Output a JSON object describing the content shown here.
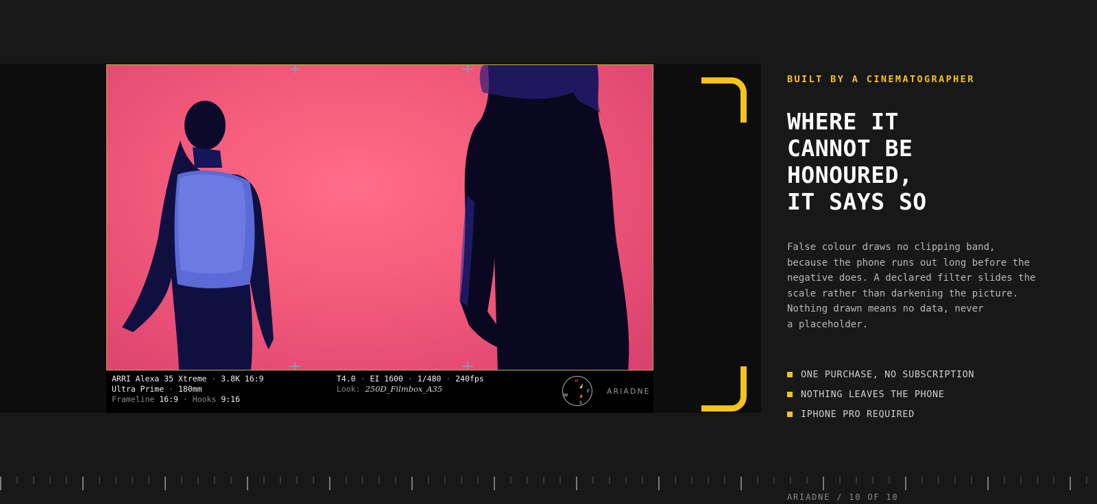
{
  "viewer": {
    "camera": "ARRI Alexa 35 Xtreme",
    "resolution": "3.8K 16:9",
    "lens": "Ultra Prime",
    "focal": "180mm",
    "frameline_label": "Frameline",
    "frameline_value": "16:9",
    "hooks_label": "Hooks",
    "hooks_value": "9:16",
    "stop": "T4.0",
    "ei": "EI 1600",
    "shutter": "1/480",
    "fps": "240fps",
    "look_label": "Look:",
    "look_value": "250D_Filmbox_A35",
    "separator": "·",
    "compass": {
      "n": "N",
      "e": "E",
      "s": "S",
      "w": "W"
    },
    "logo": "ARIADNE"
  },
  "panel": {
    "eyebrow": "BUILT BY A CINEMATOGRAPHER",
    "headline_lines": [
      "WHERE IT",
      "CANNOT BE",
      "HONOURED,",
      "IT SAYS SO"
    ],
    "body_lines": [
      "False colour draws no clipping band,",
      "because the phone runs out long before the",
      "negative does. A declared filter slides the",
      "scale rather than darkening the picture.",
      "Nothing drawn means no data, never",
      "a placeholder."
    ],
    "bullets": [
      "ONE PURCHASE, NO SUBSCRIPTION",
      "NOTHING LEAVES THE PHONE",
      "IPHONE PRO REQUIRED"
    ]
  },
  "footer": {
    "label": "ARIADNE / 10 OF 10"
  },
  "colors": {
    "accent": "#f7c21b",
    "frame_border": "#c9b43a",
    "background": "#181818"
  },
  "icons": [
    "compass-icon",
    "ariadne-logo-icon",
    "bullet-square-icon",
    "corner-bracket-icon"
  ]
}
